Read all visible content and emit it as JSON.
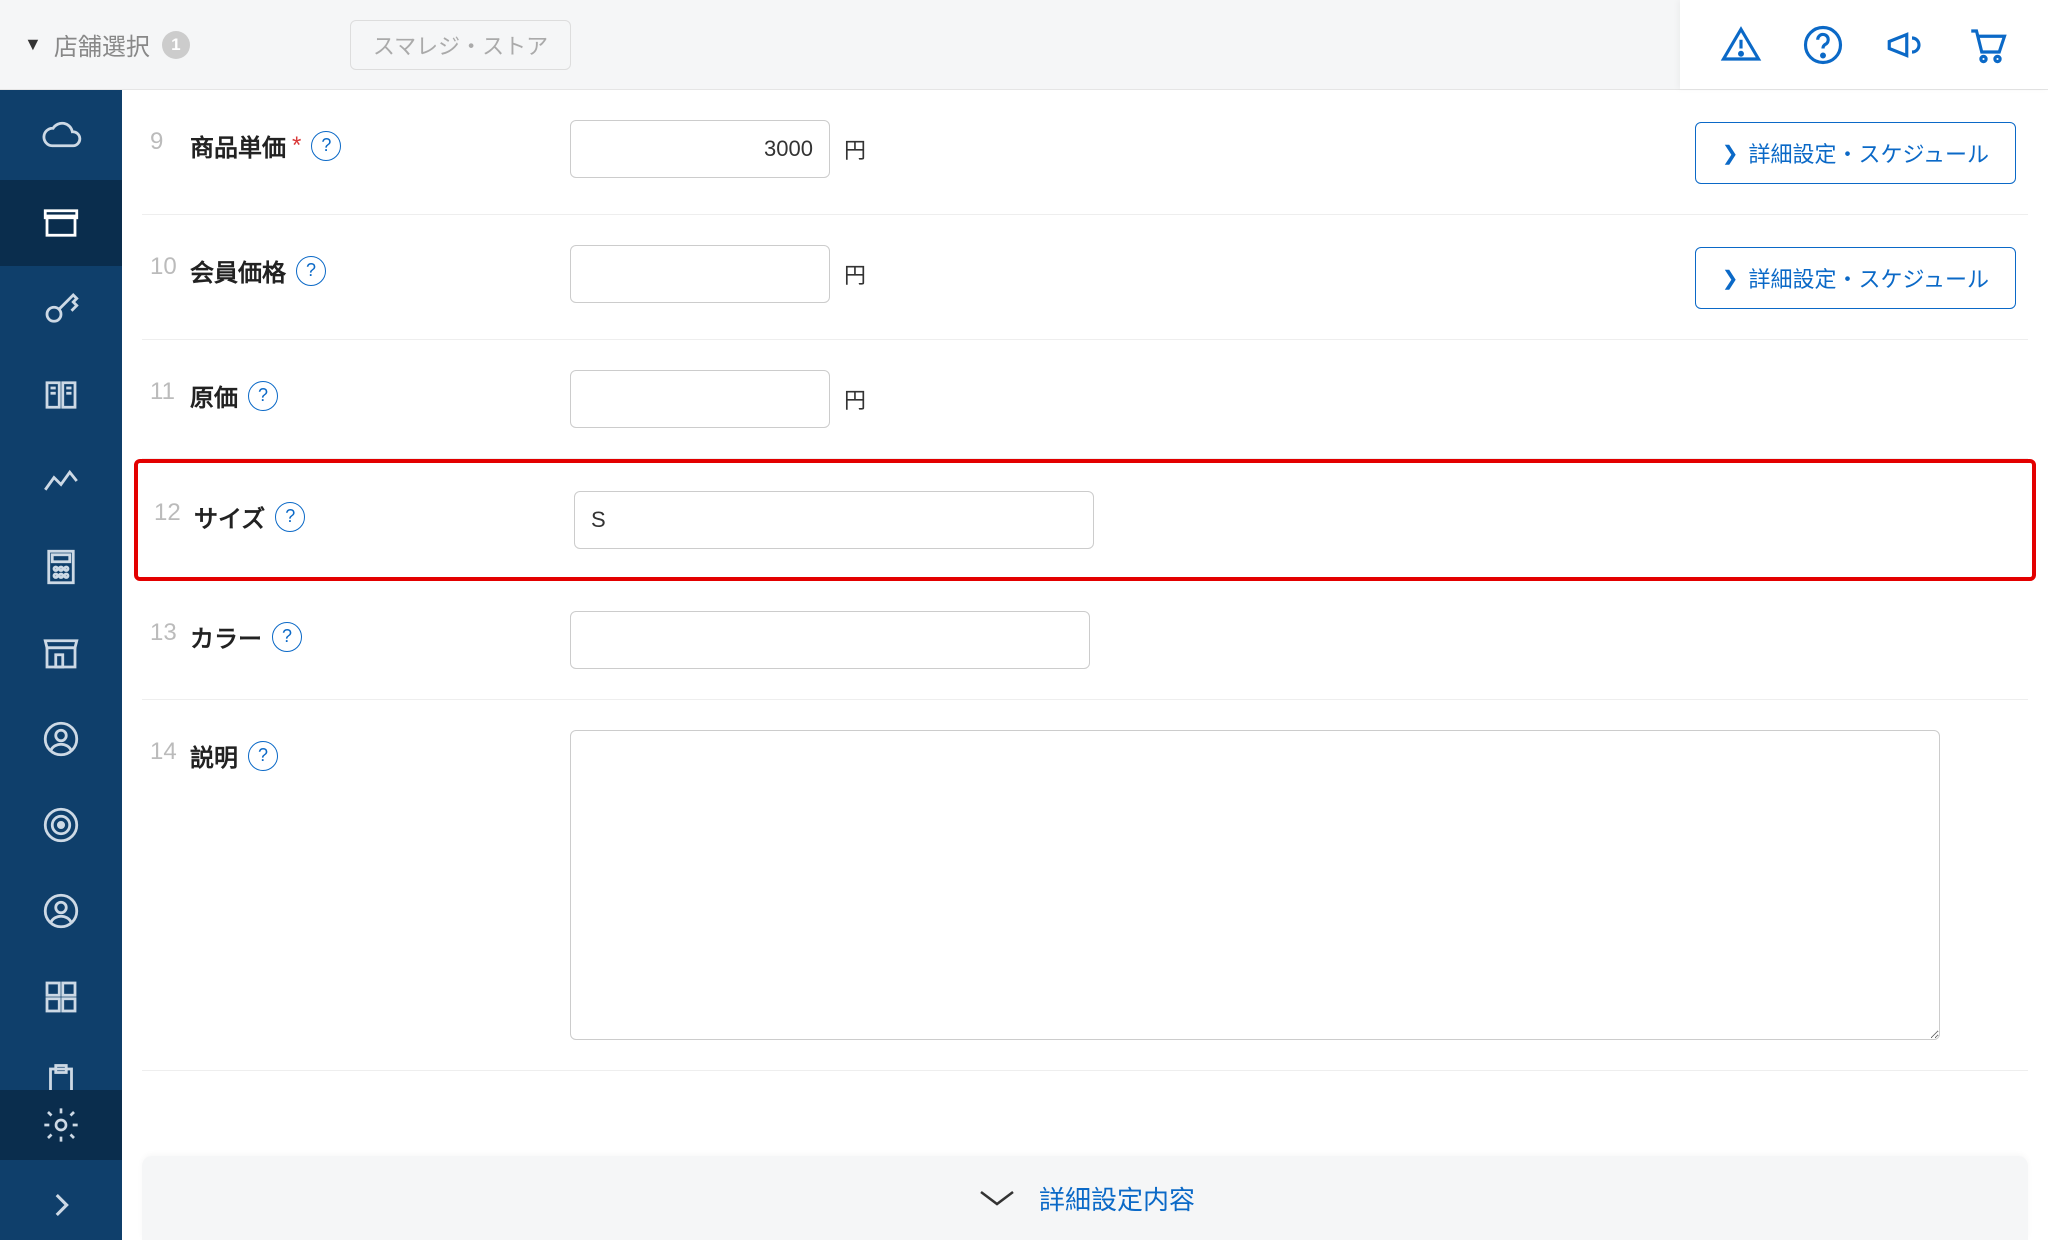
{
  "topbar": {
    "store_select_label": "店舗選択",
    "store_badge": "1",
    "store_pill": "スマレジ・ストア"
  },
  "rows": [
    {
      "num": "9",
      "label": "商品単価",
      "required": true,
      "help": true,
      "value": "3000",
      "unit": "円",
      "detail_btn": "詳細設定・スケジュール",
      "wide": false,
      "textarea": false
    },
    {
      "num": "10",
      "label": "会員価格",
      "required": false,
      "help": true,
      "value": "",
      "unit": "円",
      "detail_btn": "詳細設定・スケジュール",
      "wide": false,
      "textarea": false
    },
    {
      "num": "11",
      "label": "原価",
      "required": false,
      "help": true,
      "value": "",
      "unit": "円",
      "detail_btn": null,
      "wide": false,
      "textarea": false
    },
    {
      "num": "12",
      "label": "サイズ",
      "required": false,
      "help": true,
      "value": "S",
      "unit": null,
      "detail_btn": null,
      "wide": true,
      "textarea": false,
      "highlight": true
    },
    {
      "num": "13",
      "label": "カラー",
      "required": false,
      "help": true,
      "value": "",
      "unit": null,
      "detail_btn": null,
      "wide": true,
      "textarea": false
    },
    {
      "num": "14",
      "label": "説明",
      "required": false,
      "help": true,
      "value": "",
      "unit": null,
      "detail_btn": null,
      "wide": true,
      "textarea": true
    }
  ],
  "detail_bar_label": "詳細設定内容",
  "help_glyph": "?"
}
